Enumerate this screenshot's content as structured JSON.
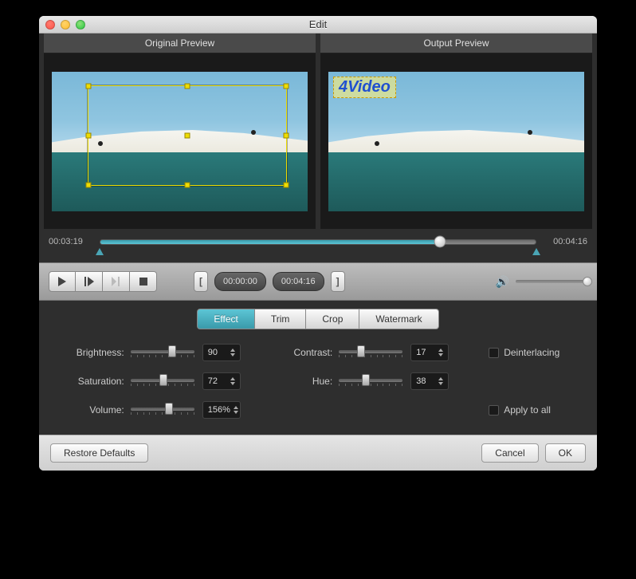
{
  "window": {
    "title": "Edit"
  },
  "previews": {
    "original_label": "Original Preview",
    "output_label": "Output Preview",
    "watermark_text": "4Video"
  },
  "timeline": {
    "current": "00:03:19",
    "duration": "00:04:16",
    "progress_pct": 78
  },
  "playback": {
    "bracket_in": "00:00:00",
    "bracket_out": "00:04:16"
  },
  "tabs": {
    "items": [
      "Effect",
      "Trim",
      "Crop",
      "Watermark"
    ],
    "active": "Effect"
  },
  "effect": {
    "brightness": {
      "label": "Brightness:",
      "value": "90",
      "pct": 65
    },
    "contrast": {
      "label": "Contrast:",
      "value": "17",
      "pct": 35
    },
    "saturation": {
      "label": "Saturation:",
      "value": "72",
      "pct": 52
    },
    "hue": {
      "label": "Hue:",
      "value": "38",
      "pct": 42
    },
    "volume": {
      "label": "Volume:",
      "value": "156%",
      "pct": 60
    },
    "deinterlacing": {
      "label": "Deinterlacing",
      "checked": false
    },
    "apply_all": {
      "label": "Apply to all",
      "checked": false
    }
  },
  "footer": {
    "restore": "Restore Defaults",
    "cancel": "Cancel",
    "ok": "OK"
  }
}
